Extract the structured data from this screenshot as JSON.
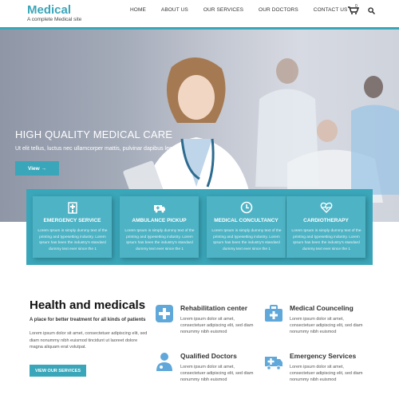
{
  "header": {
    "logo_title": "Medical",
    "logo_subtitle": "A complete Medical site",
    "nav": [
      "HOME",
      "ABOUT US",
      "OUR SERVICES",
      "OUR DOCTORS",
      "CONTACT US"
    ],
    "cart_count": "0",
    "accent": "#3aa6b9"
  },
  "hero": {
    "title": "HIGH QUALITY MEDICAL CARE",
    "subtitle": "Ut elit tellus, luctus nec ullamcorper mattis, pulvinar dapibus leo.",
    "button": "View →"
  },
  "features": [
    {
      "icon": "hospital-icon",
      "title": "EMERGENCY SERVICE",
      "text": "Lorem Ipsum is simply dummy text of the printing and typesetting industry. Lorem Ipsum has been the industry's standard dummy text ever since the 1"
    },
    {
      "icon": "ambulance-icon",
      "title": "AMBULANCE PICKUP",
      "text": "Lorem Ipsum is simply dummy text of the printing and typesetting industry. Lorem Ipsum has been the industry's standard dummy text ever since the 1"
    },
    {
      "icon": "clock-icon",
      "title": "MEDICAL CONCULTANCY",
      "text": "Lorem Ipsum is simply dummy text of the printing and typesetting industry. Lorem Ipsum has been the industry's standard dummy text ever since the 1"
    },
    {
      "icon": "heartbeat-icon",
      "title": "CARDIOTHERAPY",
      "text": "Lorem Ipsum is simply dummy text of the printing and typesetting industry. Lorem Ipsum has been the industry's standard dummy text ever since the 1"
    }
  ],
  "about": {
    "heading": "Health and medicals",
    "tagline": "A place for better treatment for all kinds of patients",
    "paragraph": "Lorem ipsum dolor sit amet, consectetuer adipiscing elit, sed diam nonummy nibh euismod tincidunt ut laoreet dolore magna aliquam erat volutpat.",
    "button": "VIEW OUR SERVICES"
  },
  "services": [
    {
      "icon": "plus-icon",
      "title": "Rehabilitation center",
      "text": "Lorem ipsum dolor sit amet, consectetuer adipiscing elit, sed diam nonummy nibh euismod"
    },
    {
      "icon": "medical-kit-icon",
      "title": "Medical Counceling",
      "text": "Lorem ipsum dolor sit amet, consectetuer adipiscing elit, sed diam nonummy nibh euismod"
    },
    {
      "icon": "doctor-icon",
      "title": "Qualified Doctors",
      "text": "Lorem ipsum dolor sit amet, consectetuer adipiscing elit, sed diam nonummy nibh euismod"
    },
    {
      "icon": "ambulance-icon",
      "title": "Emergency Services",
      "text": "Lorem ipsum dolor sit amet, consectetuer adipiscing elit, sed diam nonummy nibh euismod"
    }
  ]
}
